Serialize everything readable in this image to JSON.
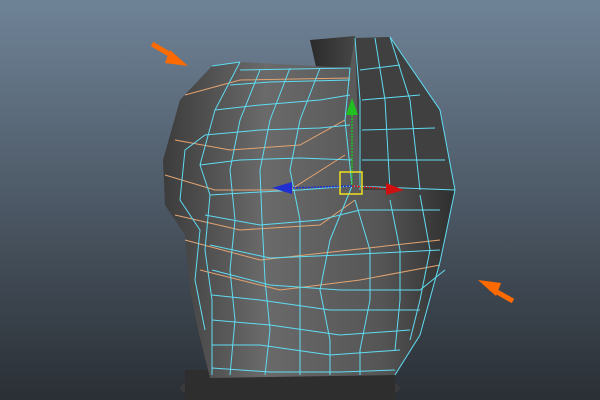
{
  "viewport": {
    "background_top": "#6f8397",
    "background_bottom": "#2a2f35",
    "mesh_color": "#5fdcf2",
    "edge_loop_color": "#e2a472",
    "surface_color": "#5a5a5a",
    "annotation_arrow_color": "#ff6a00"
  },
  "manipulator": {
    "x_axis_color": "#d01010",
    "y_axis_color": "#20c020",
    "z_axis_color": "#2030d0",
    "center_color": "#f0e020"
  },
  "icons": [
    "annotation-arrow-icon",
    "move-manipulator-icon"
  ]
}
